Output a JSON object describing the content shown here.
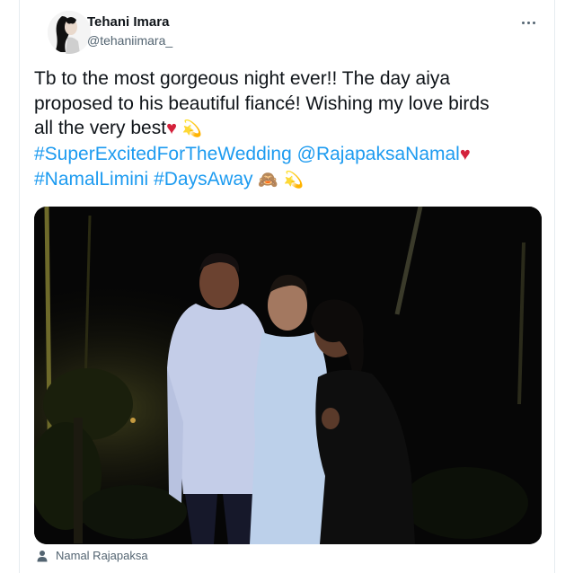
{
  "author": {
    "display_name": "Tehani Imara",
    "handle": "@tehaniimara_",
    "avatar_icon": "avatar-portrait"
  },
  "more_icon": "more-horizontal-icon",
  "tweet": {
    "line1": "Tb to the most gorgeous night ever!! The day aiya",
    "line2": "proposed to his beautiful fiancé! Wishing my love birds",
    "line3_text": "all the very best",
    "heart_emoji": "♥",
    "dizzy_emoji": "💫",
    "hashtag_wedding": "#SuperExcitedForTheWedding",
    "mention": "@RajapaksaNamal",
    "hashtag_namal": "#NamalLimini",
    "hashtag_days": "#DaysAway",
    "monkey_emoji": "🙈"
  },
  "photo": {
    "description_icon": "photo-three-people-night"
  },
  "tagged": {
    "icon": "person-icon",
    "name": "Namal Rajapaksa"
  },
  "colors": {
    "link": "#1d9bf0",
    "heart": "#d4213b",
    "secondary_text": "#536471"
  }
}
